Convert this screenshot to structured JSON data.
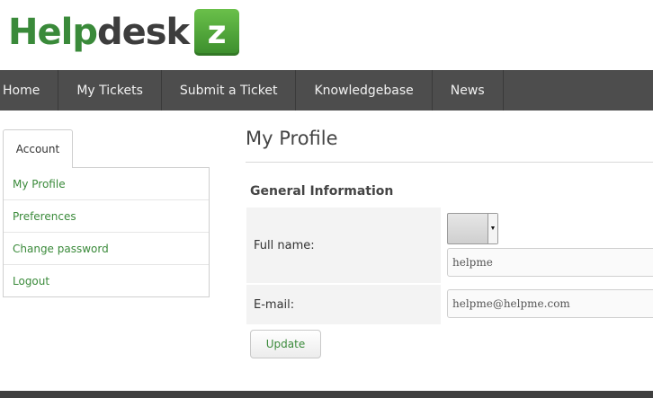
{
  "logo": {
    "part1": "Help",
    "part2": "desk",
    "badge": "z"
  },
  "nav": {
    "items": [
      {
        "label": "Home"
      },
      {
        "label": "My Tickets"
      },
      {
        "label": "Submit a Ticket"
      },
      {
        "label": "Knowledgebase"
      },
      {
        "label": "News"
      }
    ]
  },
  "sidebar": {
    "tab_label": "Account",
    "items": [
      {
        "label": "My Profile"
      },
      {
        "label": "Preferences"
      },
      {
        "label": "Change password"
      },
      {
        "label": "Logout"
      }
    ]
  },
  "main": {
    "page_title": "My Profile",
    "section_title": "General Information",
    "form": {
      "fullname_label": "Full name:",
      "title_select_value": "",
      "fullname_value": "helpme",
      "email_label": "E-mail:",
      "email_value": "helpme@helpme.com",
      "update_label": "Update"
    }
  },
  "colors": {
    "accent_green": "#3a8a3a",
    "nav_bg": "#4d4d4d",
    "label_bg": "#f3f3f3"
  },
  "icons": {
    "select_arrow": "chevron-down-icon"
  }
}
